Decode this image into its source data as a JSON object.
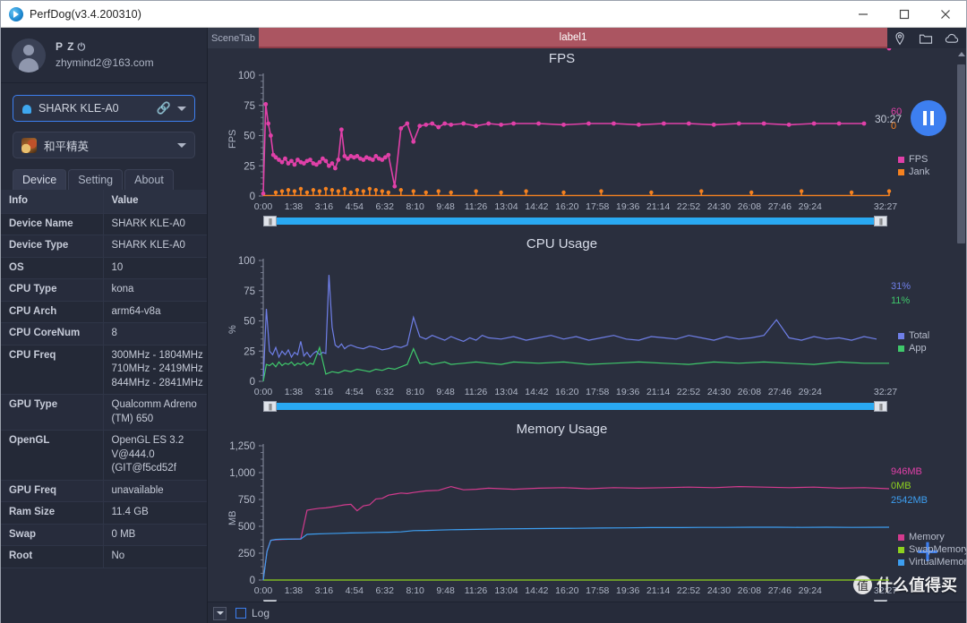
{
  "window": {
    "title": "PerfDog(v3.4.200310)",
    "logo_icon": "perfdog-logo-icon",
    "minimize_label": "–",
    "maximize_label": "□",
    "close_label": "✕"
  },
  "sidebar": {
    "account": {
      "name": "P Z",
      "power_icon": "power-icon",
      "email": "zhymind2@163.com",
      "avatar_icon": "avatar-icon"
    },
    "device_selector": {
      "icon": "android-icon",
      "value": "SHARK KLE-A0",
      "link_icon": "usb-link-icon",
      "caret_icon": "chevron-down-icon"
    },
    "app_selector": {
      "icon": "game-app-icon",
      "value": "和平精英",
      "caret_icon": "chevron-down-icon"
    },
    "tabs": [
      {
        "label": "Device",
        "active": true
      },
      {
        "label": "Setting",
        "active": false
      },
      {
        "label": "About",
        "active": false
      }
    ],
    "table": {
      "headers": [
        "Info",
        "Value"
      ],
      "rows": [
        {
          "key": "Device Name",
          "value": "SHARK KLE-A0"
        },
        {
          "key": "Device Type",
          "value": "SHARK KLE-A0"
        },
        {
          "key": "OS",
          "value": "10"
        },
        {
          "key": "CPU Type",
          "value": "kona"
        },
        {
          "key": "CPU Arch",
          "value": "arm64-v8a"
        },
        {
          "key": "CPU CoreNum",
          "value": "8"
        },
        {
          "key": "CPU Freq",
          "value": "300MHz - 1804MHz\n710MHz - 2419MHz\n844MHz - 2841MHz"
        },
        {
          "key": "GPU Type",
          "value": "Qualcomm Adreno (TM) 650"
        },
        {
          "key": "OpenGL",
          "value": "OpenGL ES 3.2 V@444.0 (GIT@f5cd52f"
        },
        {
          "key": "GPU Freq",
          "value": "unavailable"
        },
        {
          "key": "Ram Size",
          "value": "11.4 GB"
        },
        {
          "key": "Swap",
          "value": "0 MB"
        },
        {
          "key": "Root",
          "value": "No"
        }
      ]
    }
  },
  "scenebar": {
    "scene_tab_label": "SceneTab",
    "active_label": "label1",
    "active_color": "#ab5561",
    "icons": [
      "location-pin-icon",
      "folder-icon",
      "cloud-icon"
    ]
  },
  "recording": {
    "timecode": "30:27",
    "pause_icon": "pause-icon"
  },
  "statusbar": {
    "expand_icon": "chevron-down-icon",
    "log_label": "Log",
    "log_checked": false
  },
  "add_button": {
    "icon": "plus-icon",
    "label": "+"
  },
  "watermark": {
    "badge": "值",
    "text": "什么值得买"
  },
  "xticks": [
    "0:00",
    "1:38",
    "3:16",
    "4:54",
    "6:32",
    "8:10",
    "9:48",
    "11:26",
    "13:04",
    "14:42",
    "16:20",
    "17:58",
    "19:36",
    "21:14",
    "22:52",
    "24:30",
    "26:08",
    "27:46",
    "29:24"
  ],
  "xend": "32:27",
  "scrollbar": {
    "handle_icon": "resize-handle-icon"
  },
  "chart_data": [
    {
      "type": "line",
      "title": "FPS",
      "ylabel": "FPS",
      "xlabel": "",
      "ylim": [
        0,
        100
      ],
      "yticks": [
        0,
        25,
        50,
        75,
        100
      ],
      "xlim_labels": [
        "0:00",
        "32:27"
      ],
      "grid": false,
      "legend_position": "right",
      "readouts": [
        {
          "label": "60",
          "color": "#e040a8"
        },
        {
          "label": "0",
          "color": "#f58220"
        }
      ],
      "series": [
        {
          "name": "FPS",
          "color": "#e040a8",
          "x": [
            0,
            0.4,
            0.8,
            1.2,
            1.6,
            2,
            2.5,
            3,
            3.5,
            4,
            4.5,
            5,
            5.5,
            6,
            6.5,
            7,
            7.5,
            8,
            8.5,
            9,
            9.5,
            10,
            10.5,
            11,
            11.5,
            12,
            12.5,
            13,
            13.5,
            14,
            14.5,
            15,
            15.5,
            16,
            16.5,
            17,
            17.5,
            18,
            18.5,
            19,
            19.5,
            20,
            21,
            22,
            23,
            24,
            25,
            26,
            27,
            28,
            29,
            30,
            32,
            34,
            36,
            38,
            40,
            44,
            48,
            52,
            56,
            60,
            64,
            68,
            72,
            76,
            80,
            84,
            88,
            92,
            96,
            100
          ],
          "y": [
            2,
            76,
            60,
            50,
            34,
            32,
            30,
            28,
            31,
            27,
            29,
            26,
            30,
            28,
            27,
            29,
            30,
            27,
            26,
            28,
            31,
            29,
            25,
            27,
            23,
            30,
            55,
            33,
            31,
            33,
            32,
            33,
            31,
            30,
            32,
            31,
            30,
            33,
            31,
            30,
            32,
            34,
            8,
            56,
            60,
            45,
            58,
            59,
            60,
            57,
            60,
            59,
            60,
            58,
            60,
            59,
            60,
            60,
            59,
            60,
            60,
            59,
            60,
            60,
            59,
            60,
            60,
            59,
            60,
            60,
            60
          ]
        },
        {
          "name": "Jank",
          "color": "#f58220",
          "x": [
            2,
            3,
            4,
            5,
            6,
            7,
            8,
            9,
            10,
            11,
            12,
            13,
            14,
            15,
            16,
            17,
            18,
            19,
            20,
            22,
            24,
            26,
            28,
            30,
            34,
            38,
            42,
            48,
            54,
            62,
            70,
            78,
            86,
            94,
            100
          ],
          "y": [
            3,
            4,
            5,
            4,
            6,
            3,
            5,
            4,
            6,
            5,
            4,
            6,
            3,
            5,
            4,
            6,
            5,
            4,
            3,
            5,
            4,
            3,
            4,
            3,
            4,
            3,
            4,
            3,
            4,
            3,
            4,
            3,
            4,
            3,
            4
          ]
        }
      ],
      "legend": [
        {
          "label": "FPS",
          "color": "#e040a8"
        },
        {
          "label": "Jank",
          "color": "#f58220"
        }
      ]
    },
    {
      "type": "line",
      "title": "CPU Usage",
      "ylabel": "%",
      "xlabel": "",
      "ylim": [
        0,
        100
      ],
      "yticks": [
        0,
        25,
        50,
        75,
        100
      ],
      "grid": false,
      "legend_position": "right",
      "readouts": [
        {
          "label": "31%",
          "color": "#6f7fe8"
        },
        {
          "label": "11%",
          "color": "#3fc86b"
        }
      ],
      "series": [
        {
          "name": "Total",
          "color": "#6f7fe8",
          "x": [
            0,
            0.5,
            1,
            1.5,
            2,
            2.5,
            3,
            3.5,
            4,
            4.5,
            5,
            5.5,
            6,
            6.5,
            7,
            7.5,
            8,
            8.5,
            9,
            9.5,
            10,
            10.5,
            11,
            11.5,
            12,
            12.5,
            13,
            13.5,
            14,
            15,
            16,
            17,
            18,
            19,
            20,
            21,
            22,
            23,
            24,
            25,
            26,
            27,
            28,
            29,
            30,
            31,
            32,
            33,
            34,
            35,
            36,
            38,
            40,
            42,
            44,
            46,
            48,
            50,
            52,
            54,
            56,
            58,
            60,
            62,
            64,
            66,
            68,
            70,
            72,
            74,
            76,
            78,
            80,
            82,
            84,
            86,
            88,
            90,
            92,
            94,
            96,
            98,
            100
          ],
          "y": [
            0,
            60,
            25,
            22,
            28,
            20,
            25,
            22,
            26,
            20,
            24,
            22,
            33,
            21,
            24,
            20,
            23,
            25,
            22,
            24,
            23,
            88,
            45,
            30,
            28,
            31,
            27,
            29,
            30,
            28,
            27,
            29,
            28,
            26,
            27,
            29,
            28,
            30,
            53,
            37,
            35,
            38,
            36,
            34,
            37,
            35,
            33,
            36,
            34,
            38,
            36,
            35,
            37,
            34,
            36,
            38,
            35,
            37,
            34,
            36,
            38,
            35,
            34,
            37,
            36,
            35,
            38,
            36,
            34,
            37,
            35,
            36,
            38,
            51,
            36,
            34,
            37,
            35,
            36,
            34,
            37,
            35
          ]
        },
        {
          "name": "App",
          "color": "#3fc86b",
          "x": [
            0,
            0.5,
            1,
            1.5,
            2,
            2.5,
            3,
            3.5,
            4,
            4.5,
            5,
            5.5,
            6,
            6.5,
            7,
            7.5,
            8,
            9,
            10,
            11,
            12,
            13,
            14,
            15,
            16,
            17,
            18,
            19,
            20,
            21,
            22,
            23,
            24,
            25,
            26,
            27,
            28,
            29,
            30,
            32,
            34,
            36,
            38,
            40,
            44,
            48,
            52,
            56,
            60,
            64,
            68,
            72,
            76,
            80,
            84,
            88,
            92,
            96,
            100
          ],
          "y": [
            0,
            14,
            13,
            15,
            12,
            16,
            13,
            15,
            14,
            16,
            13,
            15,
            14,
            16,
            13,
            15,
            14,
            28,
            6,
            8,
            7,
            9,
            8,
            10,
            9,
            8,
            10,
            9,
            11,
            10,
            12,
            14,
            27,
            15,
            16,
            14,
            15,
            16,
            14,
            15,
            16,
            15,
            14,
            16,
            15,
            16,
            14,
            15,
            16,
            15,
            14,
            16,
            15,
            16,
            15,
            14,
            16,
            15,
            15
          ]
        }
      ],
      "legend": [
        {
          "label": "Total",
          "color": "#6f7fe8"
        },
        {
          "label": "App",
          "color": "#3fc86b"
        }
      ]
    },
    {
      "type": "line",
      "title": "Memory Usage",
      "ylabel": "MB",
      "xlabel": "",
      "ylim": [
        0,
        1250
      ],
      "yticks": [
        0,
        250,
        500,
        750,
        1000,
        1250
      ],
      "grid": false,
      "legend_position": "right",
      "readouts": [
        {
          "label": "946MB",
          "color": "#e040a8"
        },
        {
          "label": "0MB",
          "color": "#8ed11f"
        },
        {
          "label": "2542MB",
          "color": "#3d9ef0"
        }
      ],
      "series": [
        {
          "name": "Memory",
          "color": "#d33b8e",
          "x": [
            0,
            0.6,
            1.2,
            2,
            3,
            4,
            5,
            6,
            7,
            8,
            9,
            10,
            11,
            12,
            13,
            14,
            15,
            16,
            17,
            18,
            19,
            20,
            21,
            22,
            23,
            24,
            26,
            28,
            30,
            32,
            34,
            36,
            38,
            40,
            44,
            48,
            52,
            56,
            60,
            64,
            68,
            72,
            76,
            80,
            84,
            88,
            92,
            96,
            100
          ],
          "y": [
            0,
            270,
            370,
            375,
            378,
            380,
            380,
            382,
            650,
            660,
            668,
            672,
            680,
            690,
            700,
            705,
            645,
            690,
            700,
            755,
            760,
            790,
            800,
            810,
            805,
            815,
            830,
            835,
            870,
            840,
            845,
            855,
            850,
            845,
            855,
            860,
            850,
            860,
            855,
            860,
            865,
            860,
            870,
            865,
            860,
            865,
            855,
            860,
            850
          ]
        },
        {
          "name": "SwapMemory",
          "color": "#8ed11f",
          "x": [
            0,
            10,
            20,
            30,
            40,
            50,
            60,
            70,
            80,
            90,
            100
          ],
          "y": [
            0,
            0,
            0,
            0,
            0,
            0,
            0,
            0,
            0,
            0,
            0
          ]
        },
        {
          "name": "VirtualMemory",
          "color": "#3d9ef0",
          "x": [
            0,
            0.6,
            1.2,
            2,
            3,
            4,
            5,
            6,
            7,
            8,
            10,
            12,
            14,
            16,
            18,
            20,
            22,
            24,
            26,
            28,
            30,
            34,
            38,
            42,
            46,
            50,
            54,
            58,
            62,
            66,
            70,
            74,
            78,
            82,
            86,
            90,
            94,
            100
          ],
          "y": [
            0,
            265,
            370,
            378,
            380,
            380,
            382,
            382,
            425,
            428,
            432,
            435,
            438,
            440,
            443,
            445,
            448,
            460,
            462,
            465,
            468,
            472,
            476,
            478,
            480,
            482,
            484,
            486,
            488,
            488,
            490,
            490,
            492,
            492,
            490,
            492,
            490,
            492
          ]
        }
      ],
      "legend": [
        {
          "label": "Memory",
          "color": "#d33b8e"
        },
        {
          "label": "SwapMemory",
          "color": "#8ed11f"
        },
        {
          "label": "VirtualMemory",
          "color": "#3d9ef0"
        }
      ]
    }
  ]
}
